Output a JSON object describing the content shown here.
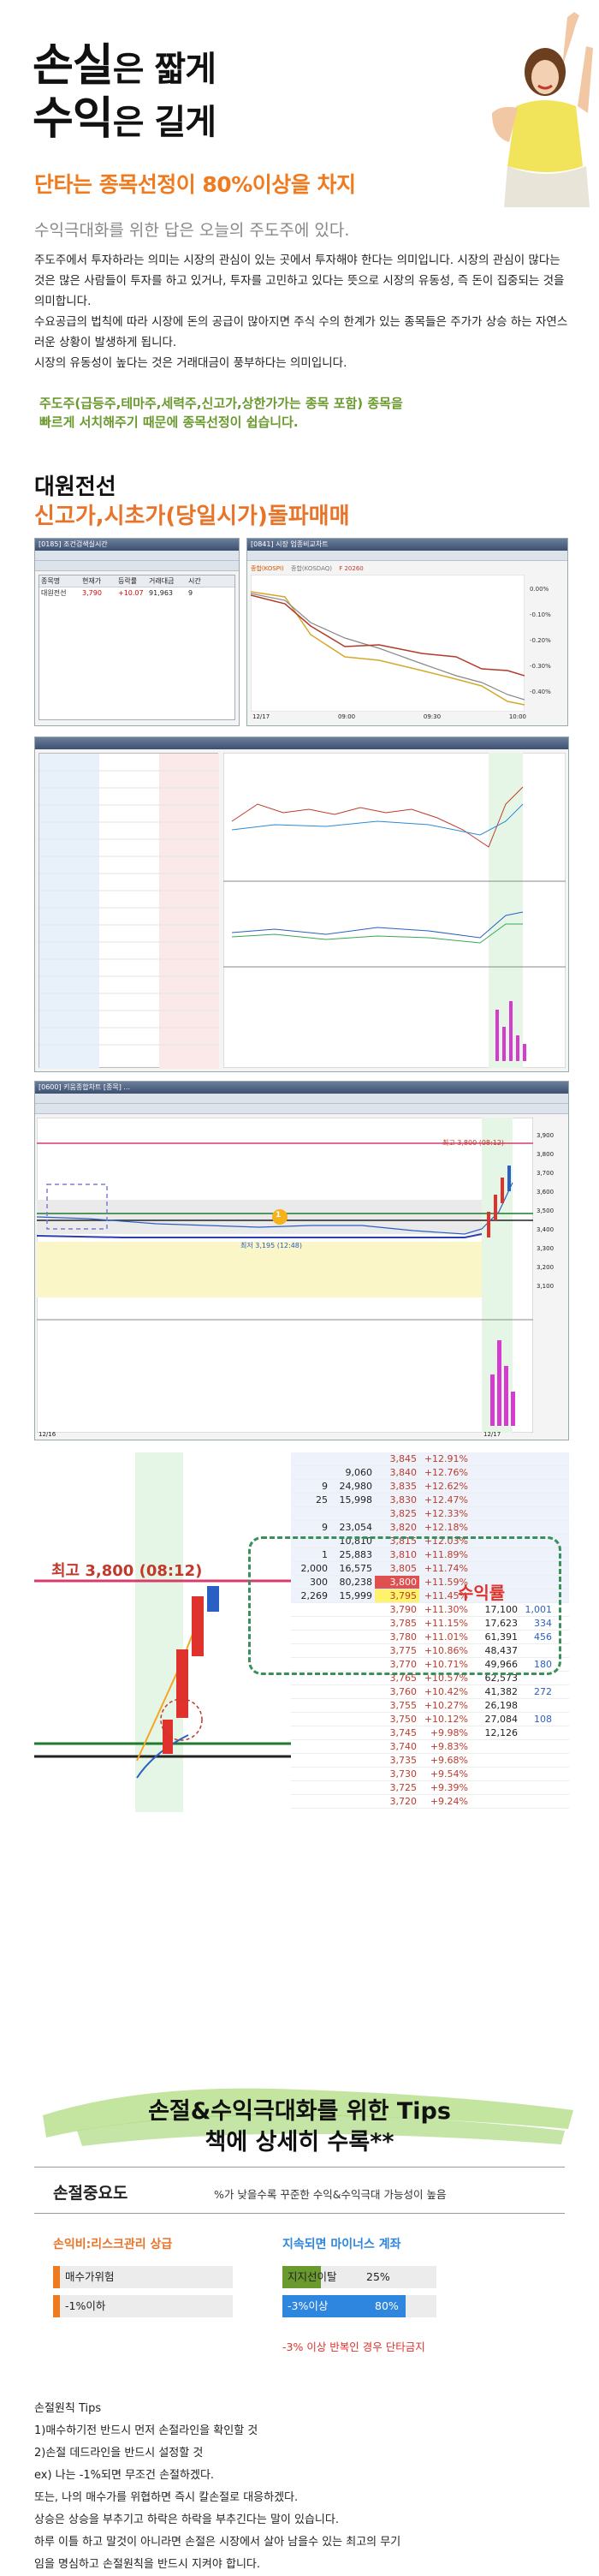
{
  "hero": {
    "line1_big": "손실",
    "line1_small": "은 짧게",
    "line2_big": "수익",
    "line2_small": "은 길게",
    "subhead": "단타는 종목선정이 80%이상을 차지",
    "lead": "수익극대화를 위한 답은 오늘의 주도주에 있다.",
    "paragraphs": [
      "주도주에서 투자하라는 의미는 시장의 관심이 있는 곳에서 투자해야 한다는 의미입니다. 시장의 관심이 많다는 것은 많은 사람들이 투자를 하고 있거나, 투자를 고민하고 있다는 뜻으로 시장의 유동성, 즉 돈이 집중되는 것을 의미합니다.",
      "수요공급의 법칙에 따라 시장에 돈의 공급이 많아지면 주식 수의 한계가 있는 종목들은 주가가 상승 하는 자연스러운 상황이 발생하게 됩니다.",
      "시장의 유동성이 높다는 것은 거래대금이 풍부하다는 의미입니다."
    ],
    "green_note_1": "주도주(급등주,테마주,세력주,신고가,상한가가는 종목 포함) 종목을",
    "green_note_2": "빠르게 서치해주기 때문에 종목선정이 쉽습니다."
  },
  "section": {
    "title": "대원전선",
    "subtitle": "신고가,시초가(당일시가)돌파매매"
  },
  "shot1": {
    "win1_title": "[0185] 조건검색실시간",
    "win2_title": "[0841] 시장 업종비교차트",
    "legend_kospi": "종합(KOSPI)",
    "legend_kosdaq": "종합(KOSDAQ)",
    "legend_f": "F 20260",
    "row_headers": [
      "종목명",
      "현재가",
      "등락률",
      "거래대금",
      "시간"
    ],
    "row_values": [
      "대원전선",
      "3,790",
      "+10.07",
      "91,963",
      "9"
    ],
    "dates": [
      "12/17",
      "09:00",
      "09:30",
      "10:00"
    ],
    "y_ticks": [
      "0.00%",
      "-0.10%",
      "-0.20%",
      "-0.30%",
      "-0.40%"
    ]
  },
  "shot3": {
    "title_bar": "[0600] 키움종합차트 [종목] ...",
    "high_label": "최고 3,800 (08:12)",
    "low_label": "최저 3,195 (12:48)",
    "badge": "1",
    "date_left": "12/16",
    "date_right": "12/17",
    "y_ticks": [
      "3,900",
      "3,800",
      "3,700",
      "3,600",
      "3,500",
      "3,400",
      "3,300",
      "3,200",
      "3,100"
    ]
  },
  "shot4": {
    "high_label": "최고 3,800 (08:12)",
    "profit_label": "수익률",
    "orderbook": [
      [
        "",
        "",
        "3,845",
        "+12.91%",
        "",
        ""
      ],
      [
        "",
        "9,060",
        "3,840",
        "+12.76%",
        "",
        ""
      ],
      [
        "9",
        "24,980",
        "3,835",
        "+12.62%",
        "",
        ""
      ],
      [
        "25",
        "15,998",
        "3,830",
        "+12.47%",
        "",
        ""
      ],
      [
        "",
        "",
        "3,825",
        "+12.33%",
        "",
        ""
      ],
      [
        "9",
        "23,054",
        "3,820",
        "+12.18%",
        "",
        ""
      ],
      [
        "",
        "10,810",
        "3,815",
        "+12.03%",
        "",
        ""
      ],
      [
        "1",
        "25,883",
        "3,810",
        "+11.89%",
        "",
        ""
      ],
      [
        "2,000",
        "16,575",
        "3,805",
        "+11.74%",
        "",
        ""
      ],
      [
        "300",
        "80,238",
        "3,800",
        "+11.59%",
        "",
        ""
      ],
      [
        "2,269",
        "15,999",
        "3,795",
        "+11.45%",
        "",
        ""
      ],
      [
        "",
        "",
        "3,790",
        "+11.30%",
        "17,100",
        "1,001"
      ],
      [
        "",
        "",
        "3,785",
        "+11.15%",
        "17,623",
        "334"
      ],
      [
        "",
        "",
        "3,780",
        "+11.01%",
        "61,391",
        "456"
      ],
      [
        "",
        "",
        "3,775",
        "+10.86%",
        "48,437",
        ""
      ],
      [
        "",
        "",
        "3,770",
        "+10.71%",
        "49,966",
        "180"
      ],
      [
        "",
        "",
        "3,765",
        "+10.57%",
        "62,573",
        ""
      ],
      [
        "",
        "",
        "3,760",
        "+10.42%",
        "41,382",
        "272"
      ],
      [
        "",
        "",
        "3,755",
        "+10.27%",
        "26,198",
        ""
      ],
      [
        "",
        "",
        "3,750",
        "+10.12%",
        "27,084",
        "108"
      ],
      [
        "",
        "",
        "3,745",
        "+9.98%",
        "12,126",
        ""
      ],
      [
        "",
        "",
        "3,740",
        "+9.83%",
        "",
        ""
      ],
      [
        "",
        "",
        "3,735",
        "+9.68%",
        "",
        ""
      ],
      [
        "",
        "",
        "3,730",
        "+9.54%",
        "",
        ""
      ],
      [
        "",
        "",
        "3,725",
        "+9.39%",
        "",
        ""
      ],
      [
        "",
        "",
        "3,720",
        "+9.24%",
        "",
        ""
      ]
    ]
  },
  "tips": {
    "title_line1": "손절&수익극대화를 위한 Tips",
    "title_line2": "책에 상세히 수록**",
    "importance_label": "손절중요도",
    "importance_note": "%가 낮을수록 꾸준한 수익&수익극대 가능성이 높음",
    "left_heading": "손익비:리스크관리 상급",
    "left_rows": [
      {
        "label": "매수가위험",
        "fill": 0.04
      },
      {
        "label": "-1%이하",
        "fill": 0.04
      }
    ],
    "right_heading": "지속되면 마이너스 계좌",
    "right_rows": [
      {
        "label": "지지선이탈",
        "value": "25%",
        "fill": 0.25
      },
      {
        "label": "-3%이상",
        "value": "80%",
        "fill": 0.8
      }
    ],
    "footnote": "-3% 이상 반복인 경우 단타금지",
    "colors": {
      "orange": "#f07a1e",
      "blue": "#2e86de",
      "green": "#6a9a2e",
      "red": "#e0322c"
    }
  },
  "rules": {
    "title": "손절원칙 Tips",
    "lines": [
      "1)매수하기전 반드시 먼저 손절라인을 확인할 것",
      "2)손절 데드라인을 반드시 설정할 것",
      "ex) 나는 -1%되면 무조건 손절하겠다.",
      "또는, 나의 매수가를 위협하면 즉시 칼손절로 대응하겠다.",
      "상승은 상승을 부추기고 하락은 하락을 부추긴다는 말이 있습니다.",
      "하루 이틀 하고 말것이 아니라면 손절은 시장에서 살아 남을수 있는 최고의 무기",
      "임을 명심하고 손절원칙을 반드시 지켜야 합니다."
    ]
  }
}
